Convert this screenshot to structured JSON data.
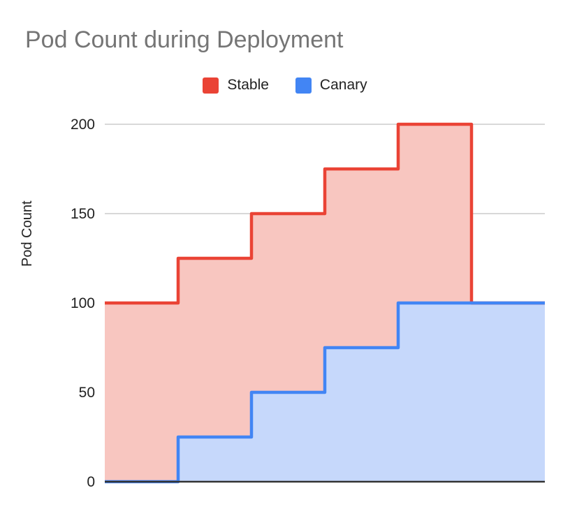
{
  "chart_data": {
    "type": "area",
    "subtype": "stepped-area",
    "title": "Pod Count during Deployment",
    "xlabel": "",
    "ylabel": "Pod Count",
    "x": [
      0,
      1,
      2,
      3,
      4,
      5
    ],
    "categories": [
      "0",
      "1",
      "2",
      "3",
      "4",
      "5"
    ],
    "series": [
      {
        "name": "Stable",
        "values": [
          100,
          125,
          150,
          175,
          200,
          100
        ],
        "color": "#EA4335",
        "fill": "#F8C6C0"
      },
      {
        "name": "Canary",
        "values": [
          0,
          25,
          50,
          75,
          100,
          100
        ],
        "color": "#4285F4",
        "fill": "#C6D8FB"
      }
    ],
    "ylim": [
      0,
      200
    ],
    "yticks": [
      0,
      50,
      100,
      150,
      200
    ],
    "ytick_labels": [
      "0",
      "50",
      "100",
      "150",
      "200"
    ],
    "xticks": [],
    "xtick_labels": [],
    "grid": true,
    "grid_axis": "y",
    "legend_position": "top-center",
    "stacked": false,
    "interpolation": "step-after"
  },
  "title": {
    "text": "Pod Count during Deployment",
    "color": "#757575"
  },
  "legend": {
    "entries": [
      {
        "label": "Stable",
        "color": "#EA4335"
      },
      {
        "label": "Canary",
        "color": "#4285F4"
      }
    ]
  },
  "axes": {
    "y": {
      "title": "Pod Count",
      "ticks": [
        "0",
        "50",
        "100",
        "150",
        "200"
      ]
    },
    "x": {
      "title": "",
      "ticks": []
    }
  },
  "colors": {
    "stable_line": "#EA4335",
    "stable_fill": "#F8C6C0",
    "canary_line": "#4285F4",
    "canary_fill": "#C6D8FB",
    "gridline": "#CCCCCC",
    "axis_line": "#333333",
    "title_text": "#757575",
    "label_text": "#222222",
    "background": "#FFFFFF"
  }
}
